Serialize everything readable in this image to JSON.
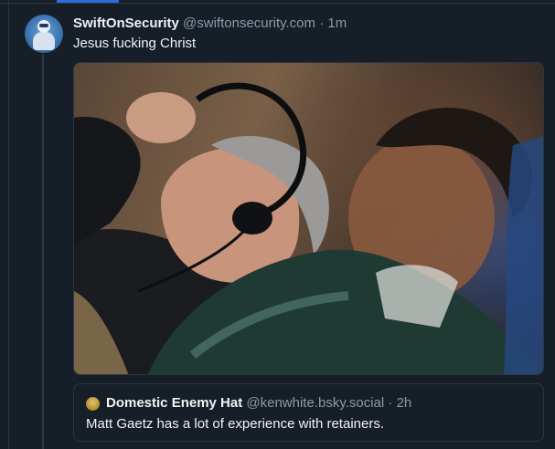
{
  "post": {
    "display_name": "SwiftOnSecurity",
    "handle": "@swiftonsecurity.com",
    "separator": "·",
    "time": "1m",
    "text": "Jesus fucking Christ"
  },
  "quote": {
    "display_name": "Domestic Enemy Hat",
    "handle": "@kenwhite.bsky.social",
    "separator": "·",
    "time": "2h",
    "text": "Matt Gaetz has a lot of experience with retainers."
  },
  "colors": {
    "background": "#161e27",
    "accent": "#2a6fdb",
    "muted_text": "#8d9aa8"
  }
}
